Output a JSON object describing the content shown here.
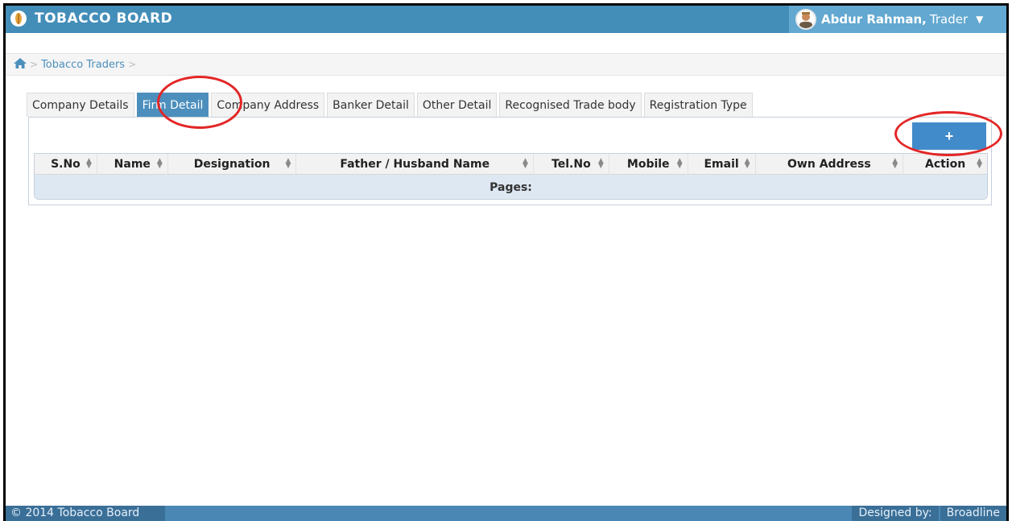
{
  "brand": {
    "title": "TOBACCO BOARD",
    "logo_icon": "leaf-logo-icon"
  },
  "user": {
    "name": "Abdur Rahman,",
    "role": "Trader",
    "caret": "▼"
  },
  "breadcrumb": {
    "home_icon": "home-icon",
    "items": [
      "Tobacco Traders"
    ]
  },
  "tabs": [
    {
      "label": "Company Details",
      "active": false
    },
    {
      "label": "Firm Detail",
      "active": true
    },
    {
      "label": "Company Address",
      "active": false
    },
    {
      "label": "Banker Detail",
      "active": false
    },
    {
      "label": "Other Detail",
      "active": false
    },
    {
      "label": "Recognised Trade body",
      "active": false
    },
    {
      "label": "Registration Type",
      "active": false
    }
  ],
  "toolbar": {
    "add_label": "+"
  },
  "table": {
    "columns": [
      "S.No",
      "Name",
      "Designation",
      "Father / Husband Name",
      "Tel.No",
      "Mobile",
      "Email",
      "Own Address",
      "Action"
    ],
    "pager_label": "Pages:"
  },
  "footer": {
    "copyright": "© 2014 Tobacco Board",
    "designed_by_label": "Designed by:",
    "designer": "Broadline"
  },
  "colors": {
    "navbar": "#438eb9",
    "active_tab": "#4c8fbd",
    "add_button": "#428bca",
    "annotation": "#e32626"
  }
}
